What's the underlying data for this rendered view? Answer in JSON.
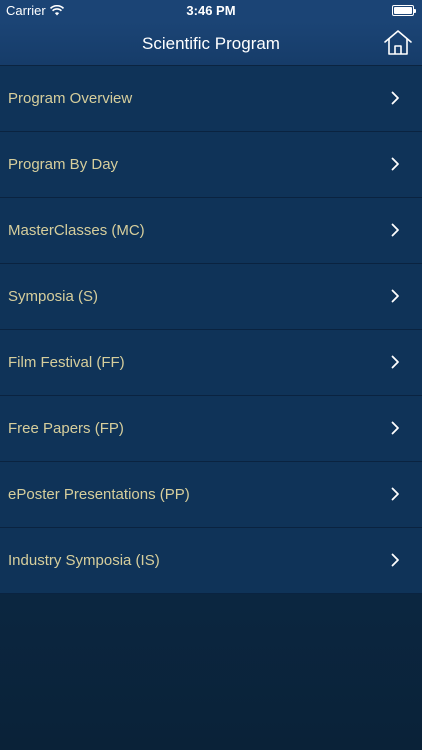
{
  "status_bar": {
    "carrier": "Carrier",
    "time": "3:46 PM"
  },
  "nav": {
    "title": "Scientific Program",
    "home_icon": "home-icon"
  },
  "menu": {
    "items": [
      {
        "label": "Program Overview"
      },
      {
        "label": "Program By Day"
      },
      {
        "label": "MasterClasses (MC)"
      },
      {
        "label": "Symposia (S)"
      },
      {
        "label": "Film Festival (FF)"
      },
      {
        "label": "Free Papers (FP)"
      },
      {
        "label": "ePoster Presentations (PP)"
      },
      {
        "label": "Industry Symposia (IS)"
      }
    ]
  },
  "colors": {
    "nav_background": "#1b4475",
    "list_background": "#0f3358",
    "label_text": "#d6ce9c",
    "separator": "#0a2340"
  }
}
